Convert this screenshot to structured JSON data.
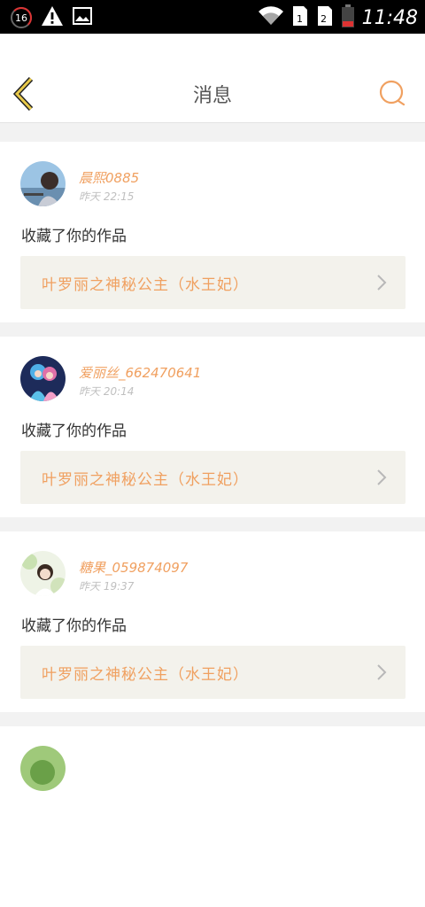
{
  "status_bar": {
    "notification_count": "16",
    "time": "11:48",
    "icons": [
      "warning-icon",
      "image-icon",
      "wifi-icon",
      "sim1-icon",
      "sim2-icon",
      "battery-icon"
    ]
  },
  "header": {
    "title": "消息",
    "back_icon": "chevron-left-icon",
    "search_icon": "search-icon"
  },
  "colors": {
    "accent": "#f0a060",
    "back": "#e8c94a",
    "card_bg": "#ffffff",
    "page_bg": "#f2f2f2",
    "work_bg": "#f3f2ec"
  },
  "messages": [
    {
      "username": "晨熙0885",
      "time": "昨天 22:15",
      "action": "收藏了你的作品",
      "work_title": "叶罗丽之神秘公主（水王妃）"
    },
    {
      "username": "爱丽丝_662470641",
      "time": "昨天 20:14",
      "action": "收藏了你的作品",
      "work_title": "叶罗丽之神秘公主（水王妃）"
    },
    {
      "username": "糖果_059874097",
      "time": "昨天 19:37",
      "action": "收藏了你的作品",
      "work_title": "叶罗丽之神秘公主（水王妃）"
    }
  ]
}
